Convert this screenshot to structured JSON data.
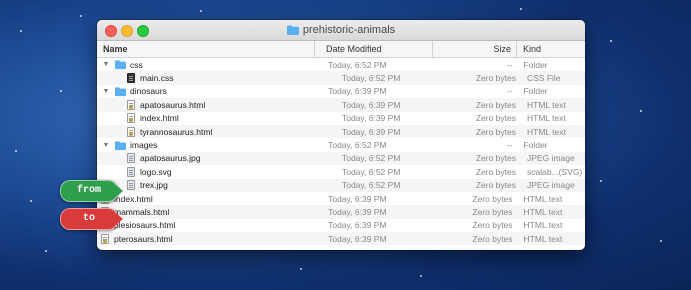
{
  "window": {
    "title": "prehistoric-animals"
  },
  "columns": {
    "name": "Name",
    "date": "Date Modified",
    "size": "Size",
    "kind": "Kind"
  },
  "rows": [
    {
      "name": "css",
      "date": "Today, 6:52 PM",
      "size": "--",
      "kind": "Folder",
      "type": "folder",
      "level": 0,
      "disclosure": "▼"
    },
    {
      "name": "main.css",
      "date": "Today, 6:52 PM",
      "size": "Zero bytes",
      "kind": "CSS File",
      "type": "css",
      "level": 1
    },
    {
      "name": "dinosaurs",
      "date": "Today, 6:39 PM",
      "size": "--",
      "kind": "Folder",
      "type": "folder",
      "level": 0,
      "disclosure": "▼"
    },
    {
      "name": "apatosaurus.html",
      "date": "Today, 6:39 PM",
      "size": "Zero bytes",
      "kind": "HTML text",
      "type": "html",
      "level": 1
    },
    {
      "name": "index.html",
      "date": "Today, 6:39 PM",
      "size": "Zero bytes",
      "kind": "HTML text",
      "type": "html",
      "level": 1
    },
    {
      "name": "tyrannosaurus.html",
      "date": "Today, 6:39 PM",
      "size": "Zero bytes",
      "kind": "HTML text",
      "type": "html",
      "level": 1
    },
    {
      "name": "images",
      "date": "Today, 6:52 PM",
      "size": "--",
      "kind": "Folder",
      "type": "folder",
      "level": 0,
      "disclosure": "▼"
    },
    {
      "name": "apatosaurus.jpg",
      "date": "Today, 6:52 PM",
      "size": "Zero bytes",
      "kind": "JPEG image",
      "type": "img",
      "level": 1
    },
    {
      "name": "logo.svg",
      "date": "Today, 6:52 PM",
      "size": "Zero bytes",
      "kind": "scalab...(SVG)",
      "type": "img",
      "level": 1
    },
    {
      "name": "trex.jpg",
      "date": "Today, 6:52 PM",
      "size": "Zero bytes",
      "kind": "JPEG image",
      "type": "img",
      "level": 1
    },
    {
      "name": "index.html",
      "date": "Today, 6:39 PM",
      "size": "Zero bytes",
      "kind": "HTML text",
      "type": "html",
      "level": 0
    },
    {
      "name": "mammals.html",
      "date": "Today, 6:39 PM",
      "size": "Zero bytes",
      "kind": "HTML text",
      "type": "html",
      "level": 0
    },
    {
      "name": "plesiosaurs.html",
      "date": "Today, 6:39 PM",
      "size": "Zero bytes",
      "kind": "HTML text",
      "type": "html",
      "level": 0
    },
    {
      "name": "pterosaurs.html",
      "date": "Today, 6:39 PM",
      "size": "Zero bytes",
      "kind": "HTML text",
      "type": "html",
      "level": 0
    }
  ],
  "tags": {
    "from": "from",
    "to": "to"
  },
  "colors": {
    "folder": "#5ab0f0",
    "from_tag": "#2f9e4d",
    "to_tag": "#d93a3a"
  }
}
